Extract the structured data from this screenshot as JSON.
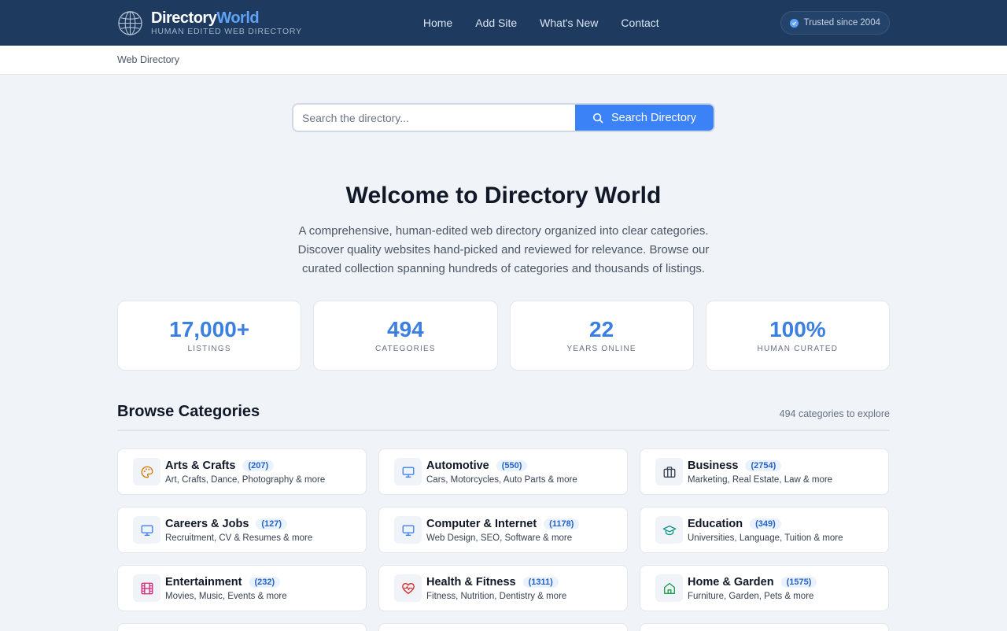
{
  "header": {
    "logo_main_a": "Directory",
    "logo_main_b": "World",
    "logo_sub": "HUMAN EDITED WEB DIRECTORY",
    "nav": [
      "Home",
      "Add Site",
      "What's New",
      "Contact"
    ],
    "badge": "Trusted since 2004"
  },
  "breadcrumb": "Web Directory",
  "search": {
    "placeholder": "Search the directory...",
    "button_label": "Search Directory"
  },
  "hero": {
    "title": "Welcome to Directory World",
    "description": "A comprehensive, human-edited web directory organized into clear categories. Discover quality websites hand-picked and reviewed for relevance. Browse our curated collection spanning hundreds of categories and thousands of listings."
  },
  "stats": [
    {
      "value": "17,000+",
      "label": "LISTINGS"
    },
    {
      "value": "494",
      "label": "CATEGORIES"
    },
    {
      "value": "22",
      "label": "YEARS ONLINE"
    },
    {
      "value": "100%",
      "label": "HUMAN CURATED"
    }
  ],
  "browse": {
    "title": "Browse Categories",
    "count_text": "494 categories to explore"
  },
  "categories": [
    {
      "name": "Arts & Crafts",
      "count": "(207)",
      "desc": "Art, Crafts, Dance, Photography & more",
      "icon": "palette-icon",
      "color": "#d97706"
    },
    {
      "name": "Automotive",
      "count": "(550)",
      "desc": "Cars, Motorcycles, Auto Parts & more",
      "icon": "monitor-icon",
      "color": "#3b82f6"
    },
    {
      "name": "Business",
      "count": "(2754)",
      "desc": "Marketing, Real Estate, Law & more",
      "icon": "briefcase-icon",
      "color": "#374151"
    },
    {
      "name": "Careers & Jobs",
      "count": "(127)",
      "desc": "Recruitment, CV & Resumes & more",
      "icon": "monitor-icon",
      "color": "#3b82f6"
    },
    {
      "name": "Computer & Internet",
      "count": "(1178)",
      "desc": "Web Design, SEO, Software & more",
      "icon": "monitor-icon",
      "color": "#3b82f6"
    },
    {
      "name": "Education",
      "count": "(349)",
      "desc": "Universities, Language, Tuition & more",
      "icon": "graduation-cap-icon",
      "color": "#0d9488"
    },
    {
      "name": "Entertainment",
      "count": "(232)",
      "desc": "Movies, Music, Events & more",
      "icon": "film-icon",
      "color": "#db2777"
    },
    {
      "name": "Health & Fitness",
      "count": "(1311)",
      "desc": "Fitness, Nutrition, Dentistry & more",
      "icon": "heart-pulse-icon",
      "color": "#dc2626"
    },
    {
      "name": "Home & Garden",
      "count": "(1575)",
      "desc": "Furniture, Garden, Pets & more",
      "icon": "home-icon",
      "color": "#16a34a"
    }
  ]
}
